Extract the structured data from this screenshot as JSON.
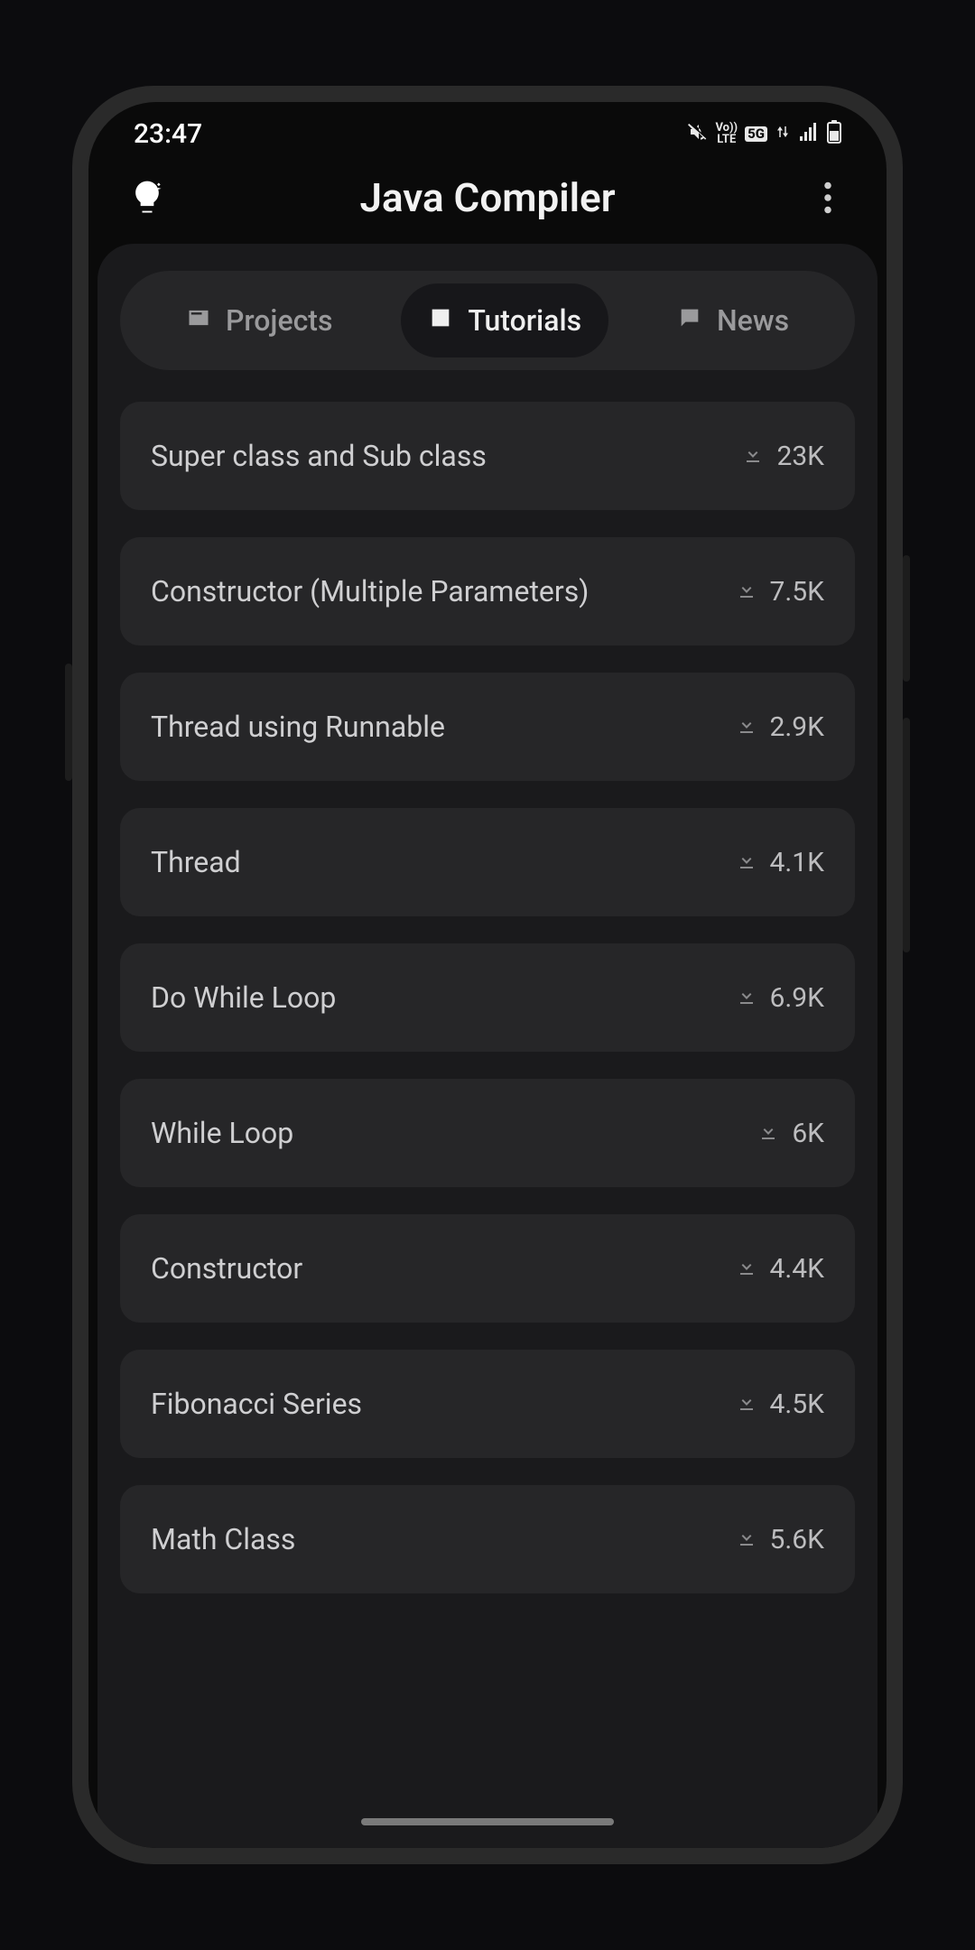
{
  "status": {
    "time": "23:47",
    "volte_top": "Vo))",
    "volte_bottom": "LTE",
    "network_badge": "5G"
  },
  "header": {
    "title": "Java Compiler"
  },
  "tabs": [
    {
      "label": "Projects",
      "active": false
    },
    {
      "label": "Tutorials",
      "active": true
    },
    {
      "label": "News",
      "active": false
    }
  ],
  "tutorials": [
    {
      "title": "Super class and Sub class",
      "downloads": "23K"
    },
    {
      "title": "Constructor (Multiple Parameters)",
      "downloads": "7.5K"
    },
    {
      "title": "Thread using Runnable",
      "downloads": "2.9K"
    },
    {
      "title": "Thread",
      "downloads": "4.1K"
    },
    {
      "title": "Do While Loop",
      "downloads": "6.9K"
    },
    {
      "title": "While Loop",
      "downloads": "6K"
    },
    {
      "title": "Constructor",
      "downloads": "4.4K"
    },
    {
      "title": "Fibonacci Series",
      "downloads": "4.5K"
    },
    {
      "title": "Math Class",
      "downloads": "5.6K"
    }
  ]
}
